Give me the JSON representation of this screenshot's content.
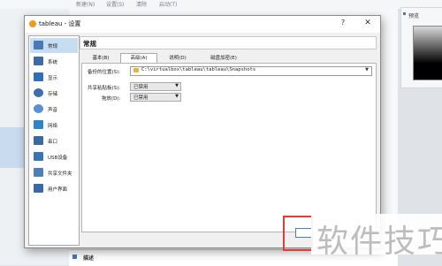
{
  "background": {
    "toolbar": [
      "新建(N)",
      "设置(S)",
      "清除",
      "启动(T)"
    ],
    "preview_title": "预览",
    "description_label": "描述"
  },
  "dialog": {
    "title": "tableau - 设置",
    "help": "?",
    "close": "✕"
  },
  "sidebar": {
    "items": [
      {
        "label": "常规",
        "icon": "general-icon",
        "color": "#4a78b8"
      },
      {
        "label": "系统",
        "icon": "system-icon",
        "color": "#3e6aa6"
      },
      {
        "label": "显示",
        "icon": "display-icon",
        "color": "#2f6fb8"
      },
      {
        "label": "存储",
        "icon": "storage-icon",
        "color": "#3d6eb0"
      },
      {
        "label": "声音",
        "icon": "audio-icon",
        "color": "#5b8fd0"
      },
      {
        "label": "网络",
        "icon": "network-icon",
        "color": "#2f84c8"
      },
      {
        "label": "串口",
        "icon": "serial-port-icon",
        "color": "#3a6aa0"
      },
      {
        "label": "USB设备",
        "icon": "usb-icon",
        "color": "#3a74b4"
      },
      {
        "label": "共享文件夹",
        "icon": "shared-folder-icon",
        "color": "#4f7fb5"
      },
      {
        "label": "用户界面",
        "icon": "user-interface-icon",
        "color": "#3a6aa6"
      }
    ],
    "selected_index": 0
  },
  "section": {
    "title": "常规"
  },
  "tabs": [
    {
      "label": "基本(B)"
    },
    {
      "label": "高级(A)"
    },
    {
      "label": "说明(D)"
    },
    {
      "label": "磁盘加密(E)"
    }
  ],
  "active_tab": 1,
  "form": {
    "snapshot_label": "备份的位置(S):",
    "snapshot_path": "C:\\virtualbox\\tableau\\tableau\\Snapshots",
    "clipboard_label": "共享粘贴板(S):",
    "clipboard_value": "已禁用",
    "dragdrop_label": "拖放(D):",
    "dragdrop_value": "已禁用"
  },
  "watermark": "软件技巧",
  "colors": {
    "accent": "#c7ddf2",
    "highlight": "#e53b35"
  }
}
